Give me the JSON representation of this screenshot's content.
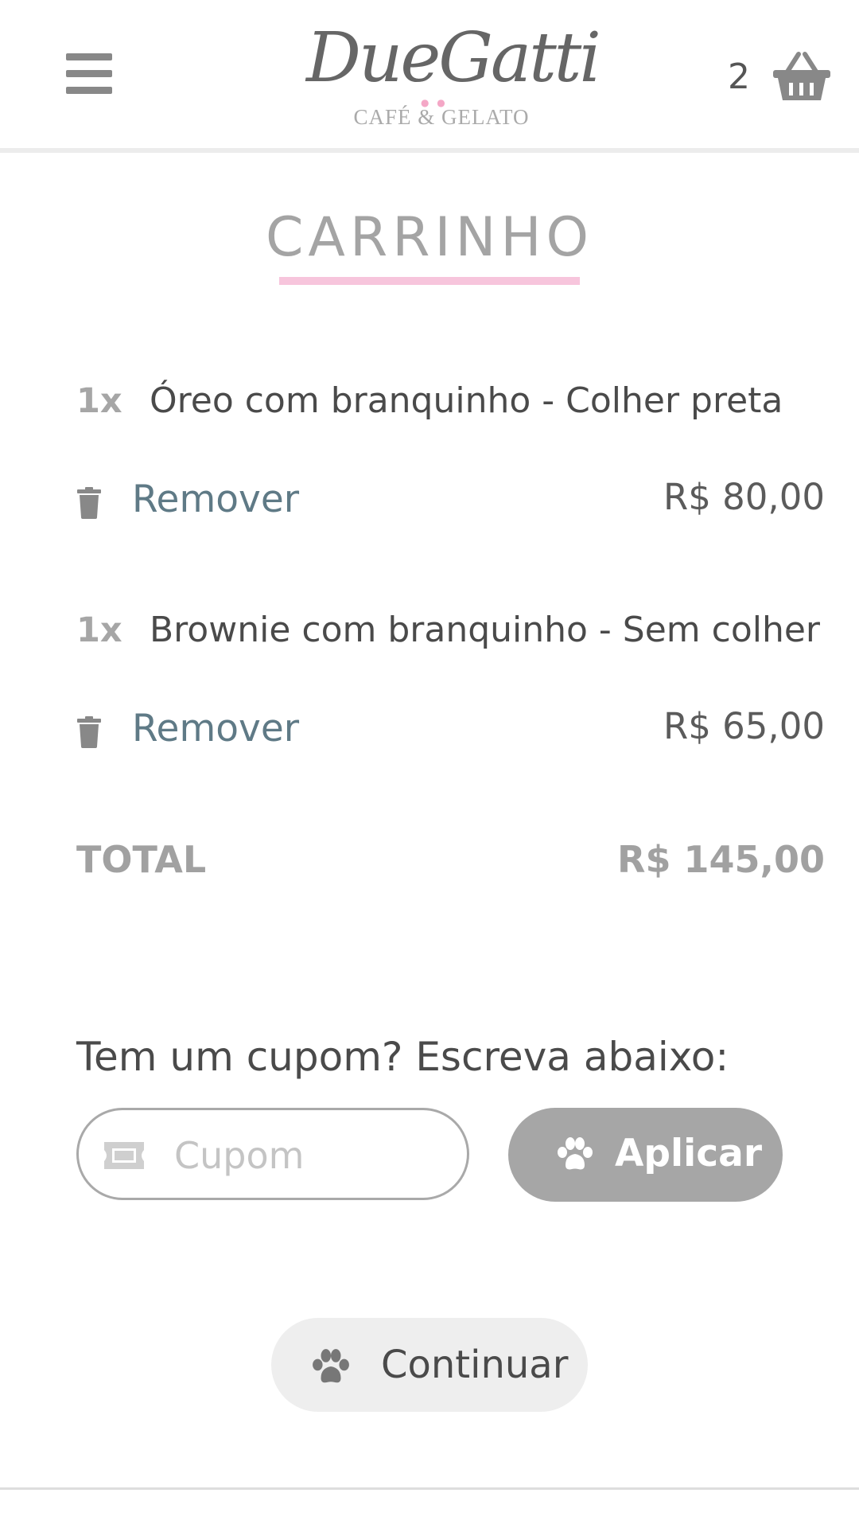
{
  "header": {
    "brand_script": "DueGatti",
    "brand_sub": "CAFÉ & GELATO",
    "cart_count": "2"
  },
  "page": {
    "title": "CARRINHO"
  },
  "items": [
    {
      "qty": "1x",
      "name": "Óreo com branquinho - Colher preta",
      "remove_label": "Remover",
      "price": "R$ 80,00"
    },
    {
      "qty": "1x",
      "name": "Brownie com branquinho - Sem colher",
      "remove_label": "Remover",
      "price": "R$ 65,00"
    }
  ],
  "total": {
    "label": "TOTAL",
    "value": "R$ 145,00"
  },
  "coupon": {
    "prompt": "Tem um cupom? Escreva abaixo:",
    "placeholder": "Cupom",
    "value": "",
    "apply_label": "Aplicar"
  },
  "continue_label": "Continuar",
  "colors": {
    "accent_pink": "#f7c5dc",
    "button_gray": "#a6a6a6",
    "link_slate": "#5f7a86"
  },
  "icons": [
    "menu-icon",
    "basket-icon",
    "trash-icon",
    "ticket-icon",
    "paw-icon"
  ]
}
